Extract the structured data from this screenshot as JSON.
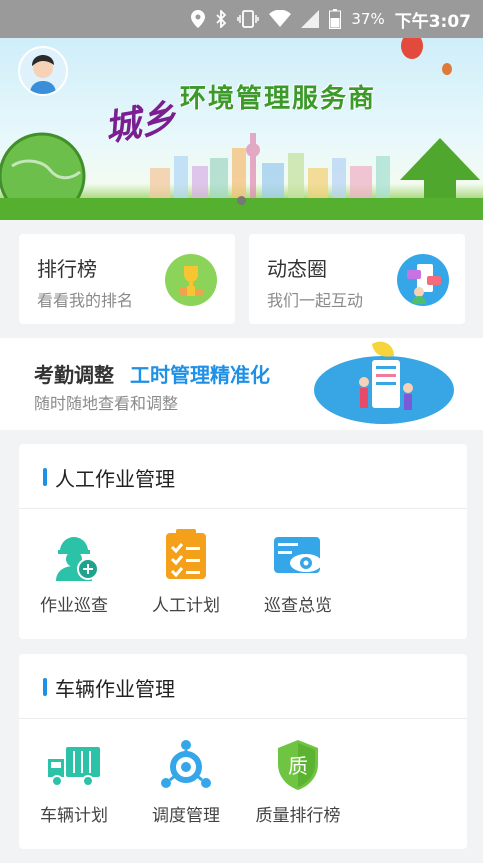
{
  "status_bar": {
    "battery": "37%",
    "time": "下午3:07"
  },
  "banner": {
    "title": "环境管理服务商",
    "script": "城乡"
  },
  "quick_links": [
    {
      "title": "排行榜",
      "subtitle": "看看我的排名"
    },
    {
      "title": "动态圈",
      "subtitle": "我们一起互动"
    }
  ],
  "attendance": {
    "title": "考勤调整",
    "highlight": "工时管理精准化",
    "subtitle": "随时随地查看和调整"
  },
  "sections": [
    {
      "title": "人工作业管理",
      "items": [
        {
          "label": "作业巡查"
        },
        {
          "label": "人工计划"
        },
        {
          "label": "巡查总览"
        }
      ]
    },
    {
      "title": "车辆作业管理",
      "items": [
        {
          "label": "车辆计划"
        },
        {
          "label": "调度管理"
        },
        {
          "label": "质量排行榜"
        }
      ]
    }
  ],
  "badges": {
    "quality_char": "质"
  },
  "colors": {
    "accent": "#1e90e6",
    "teal": "#2cc2a8",
    "orange": "#f5a01a",
    "background": "#f1f3f5"
  }
}
